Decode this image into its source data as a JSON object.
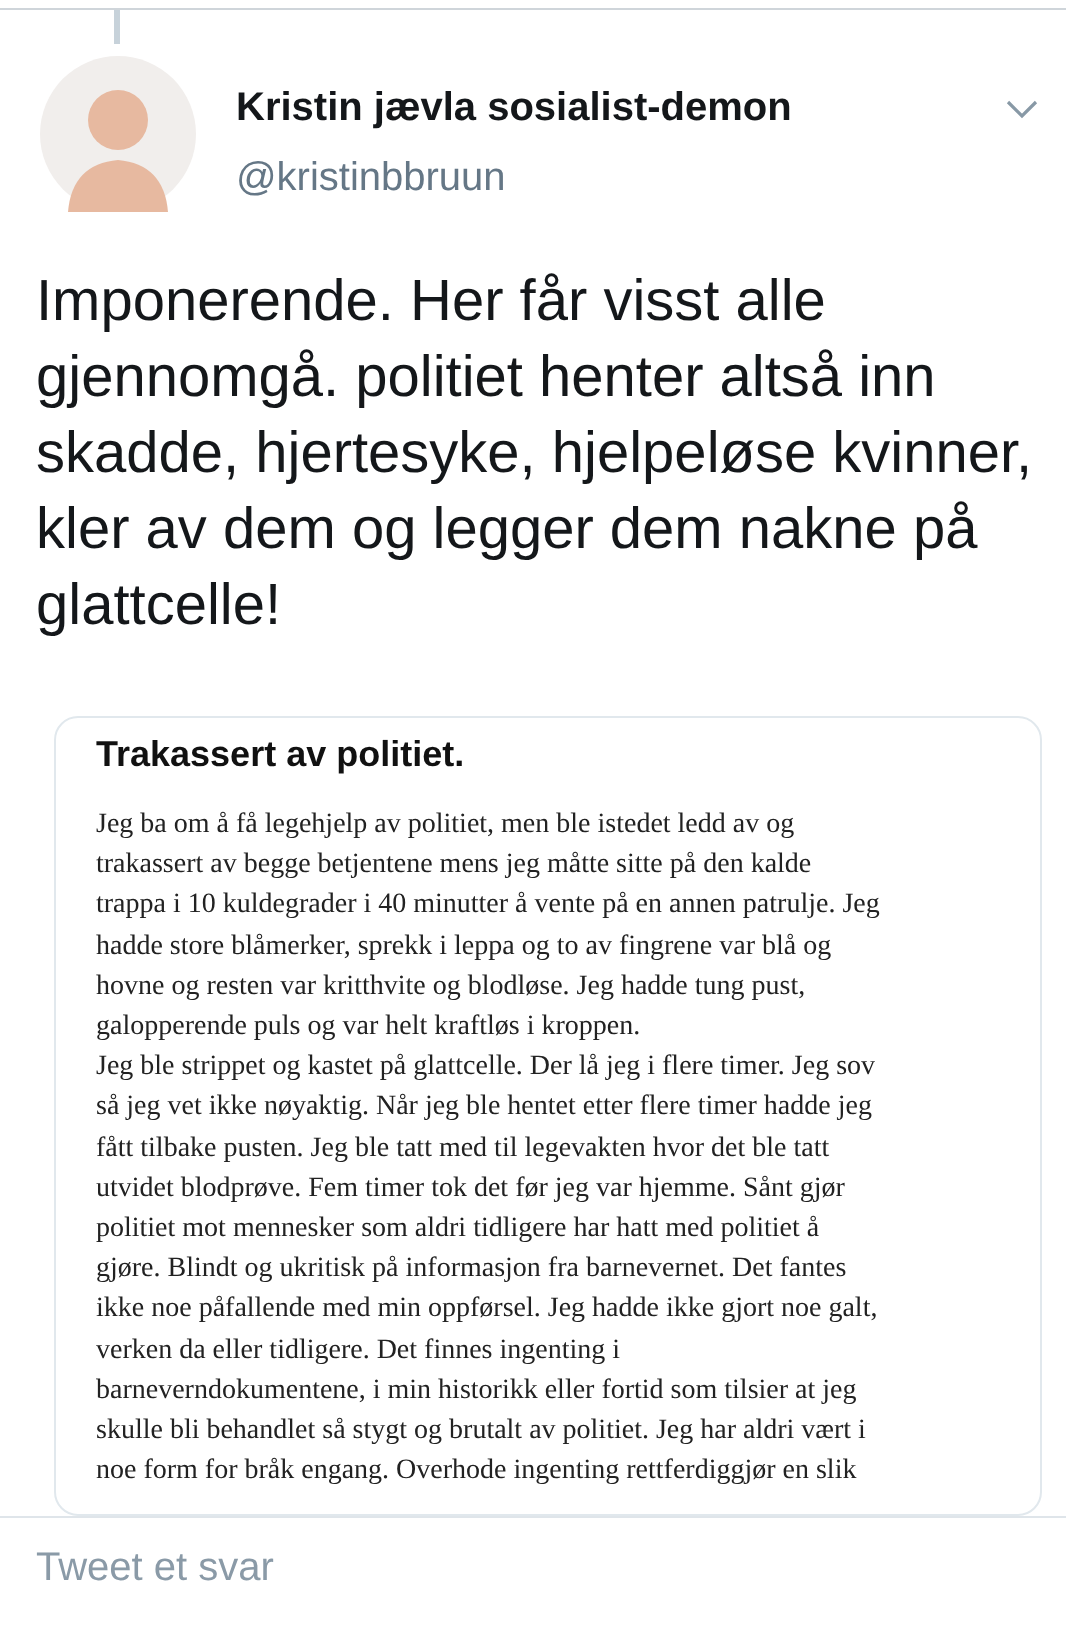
{
  "author": {
    "name": "Kristin jævla sosialist-demon",
    "handle": "@kristinbbruun"
  },
  "tweet_text": "Imponerende. Her får visst alle gjennomgå. politiet henter altså inn skadde, hjertesyke, hjelpeløse kvinner, kler av dem og legger dem nakne på glattcelle!",
  "attached_document": {
    "title": "Trakassert av politiet.",
    "lines": [
      "Jeg ba om å få legehjelp av politiet, men ble istedet ledd av og",
      "trakassert av begge betjentene mens jeg måtte sitte på den kalde",
      "trappa i 10 kuldegrader i 40 minutter å vente på en annen patrulje. Jeg",
      "hadde store blåmerker, sprekk i leppa og to av fingrene var blå og",
      "hovne og resten var kritthvite og blodløse. Jeg hadde tung pust,",
      "galopperende puls og var helt kraftløs i kroppen.",
      "Jeg ble strippet og kastet på glattcelle. Der lå jeg i flere timer. Jeg sov",
      "så jeg vet ikke nøyaktig. Når jeg ble hentet etter flere timer hadde jeg",
      "fått tilbake pusten. Jeg ble tatt med til legevakten hvor det ble tatt",
      "utvidet blodprøve. Fem timer tok det før jeg var hjemme. Sånt gjør",
      "politiet mot mennesker som aldri tidligere har hatt med politiet å",
      "gjøre. Blindt og ukritisk på informasjon fra barnevernet. Det fantes",
      "ikke noe påfallende med min oppførsel. Jeg hadde ikke gjort noe galt,",
      "verken da eller tidligere. Det finnes ingenting i",
      "barneverndokumentene, i min historikk eller fortid som tilsier at jeg",
      "skulle bli behandlet så stygt og brutalt av politiet. Jeg har aldri vært i",
      "noe form for bråk engang. Overhode ingenting rettferdiggjør en slik"
    ]
  },
  "reply_field": {
    "placeholder": "Tweet et svar"
  }
}
